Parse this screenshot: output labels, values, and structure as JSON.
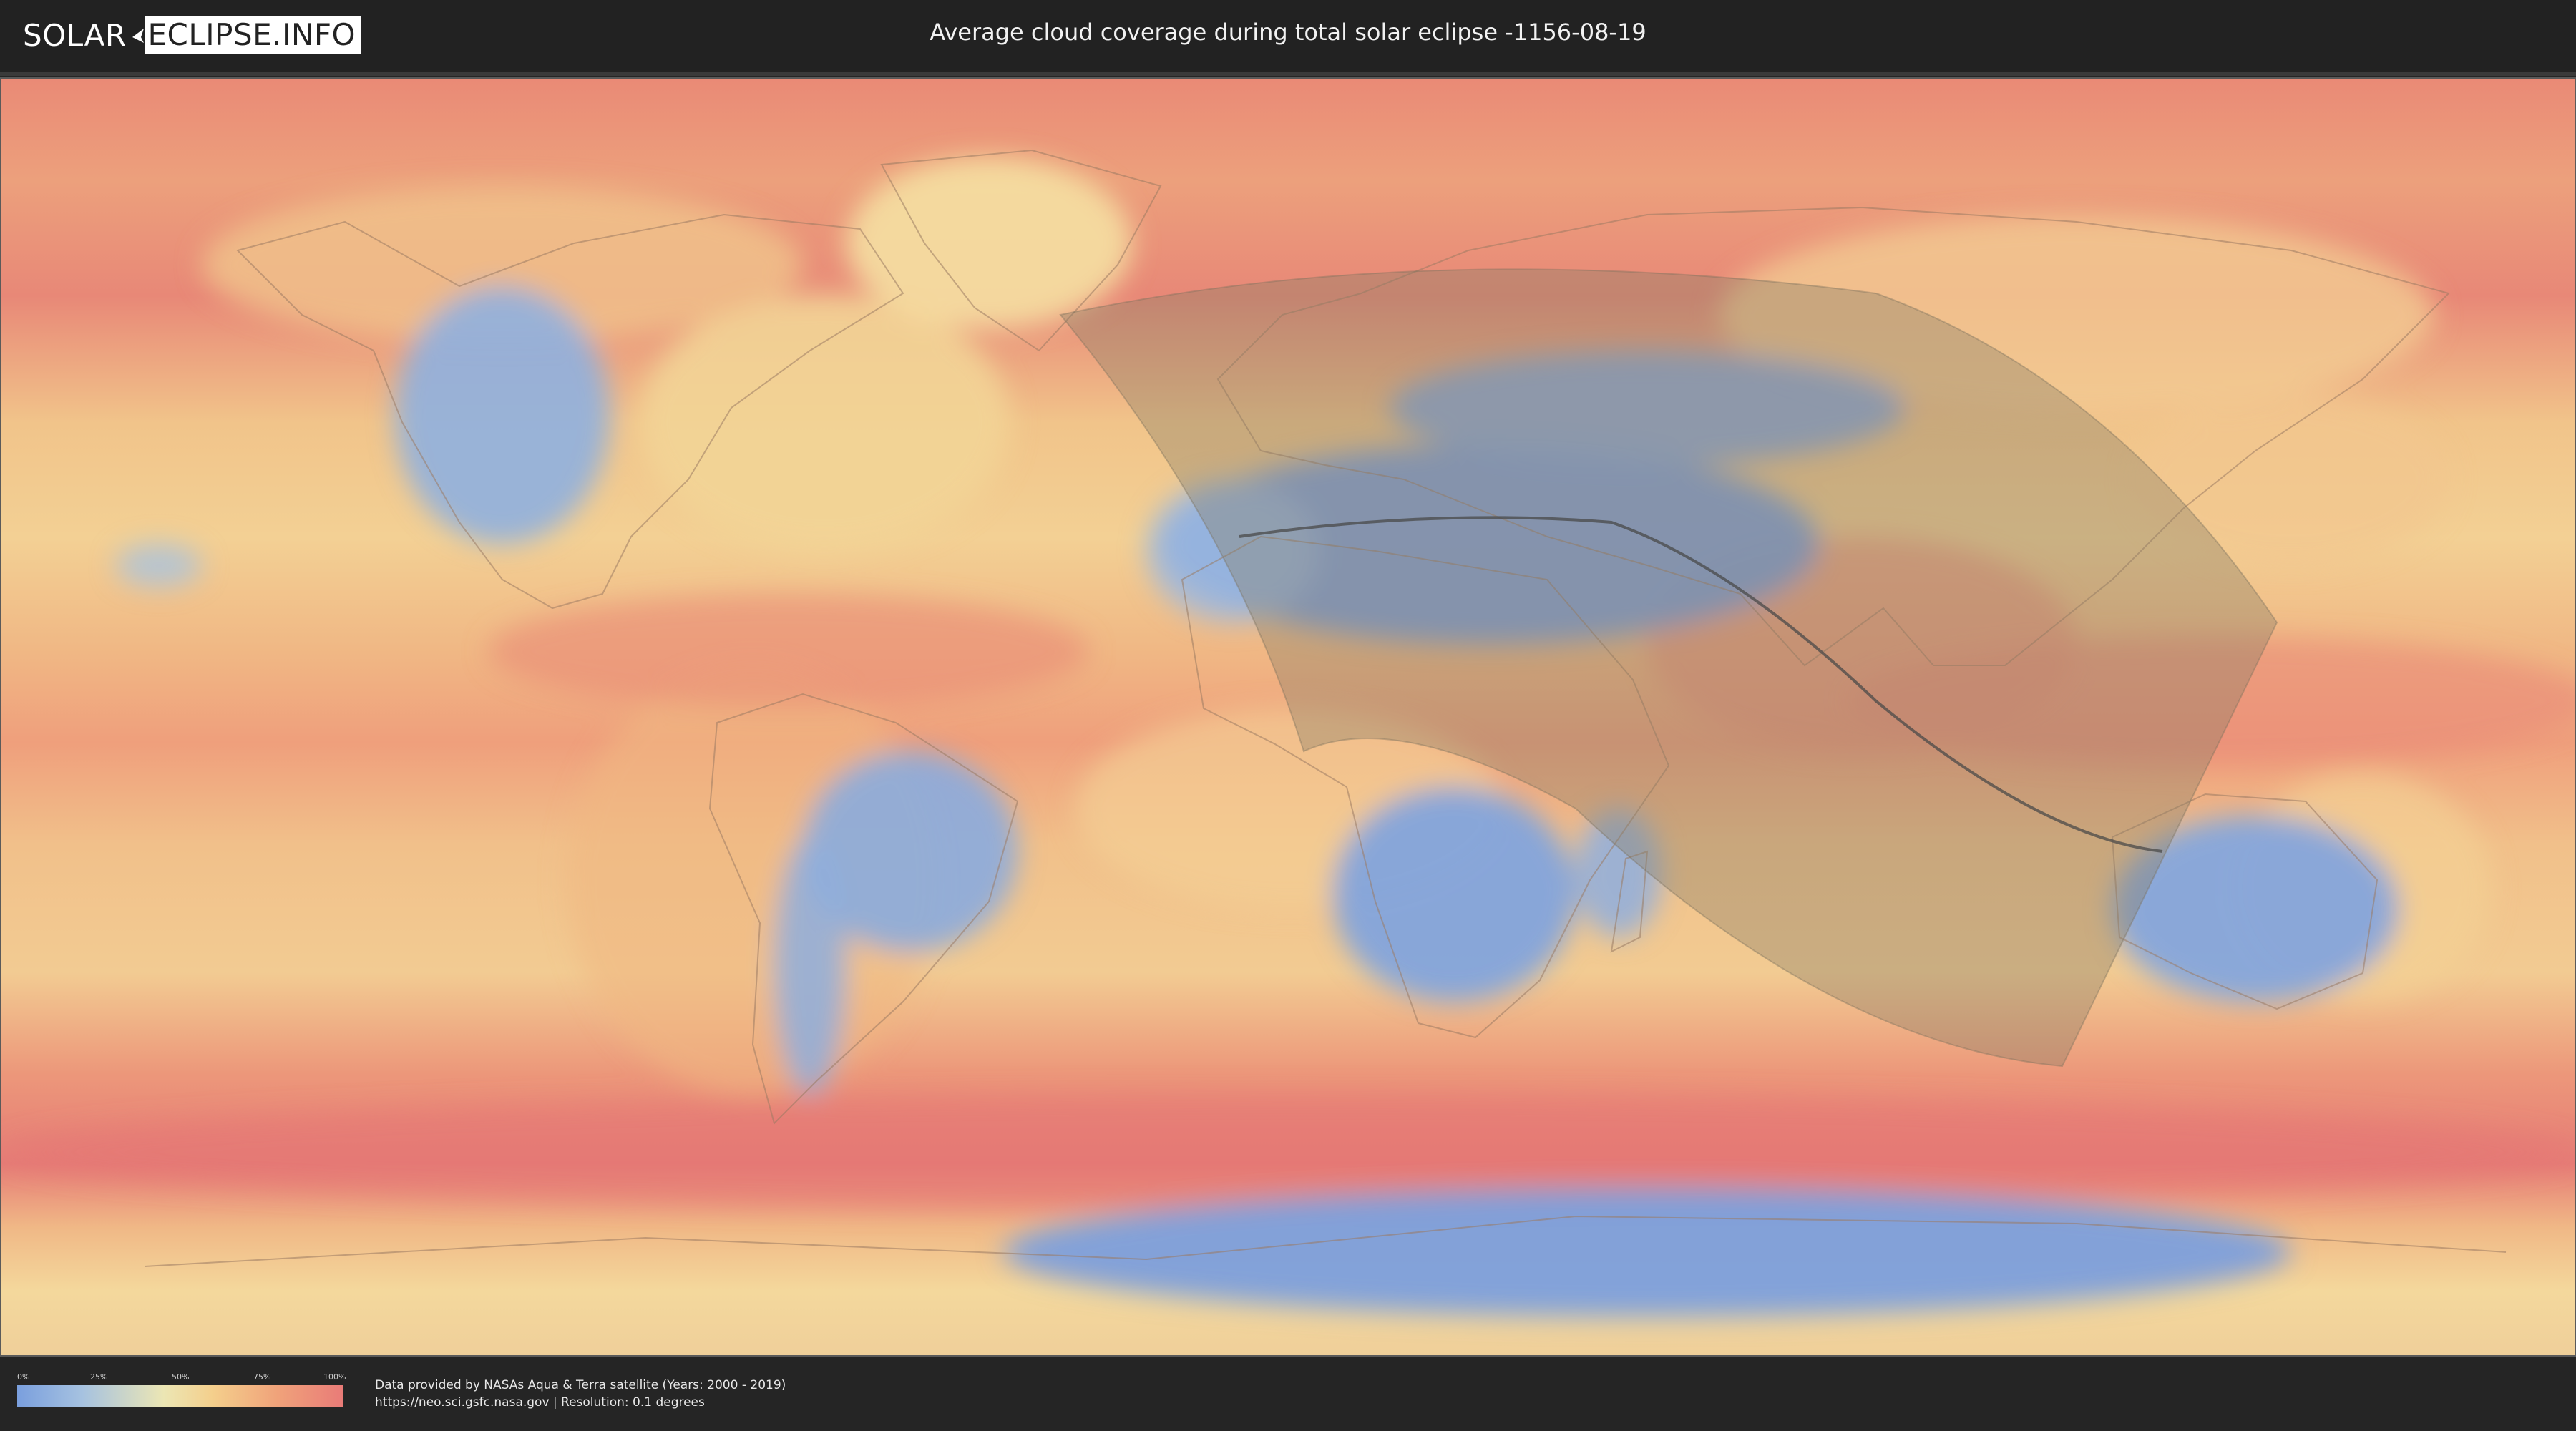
{
  "header": {
    "logo_solar": "SOLAR",
    "logo_eclipse": "ECLIPSE.INFO",
    "title": "Average cloud coverage during total solar eclipse -1156-08-19"
  },
  "map": {
    "layer": "average cloud coverage",
    "overlay": "eclipse visibility zone",
    "path": "path of totality"
  },
  "legend": {
    "ticks": [
      "0%",
      "25%",
      "50%",
      "75%",
      "100%"
    ],
    "colors": {
      "low": "#7a9fde",
      "mid": "#ece6b4",
      "high": "#e97b78"
    }
  },
  "footer": {
    "source_line1": "Data provided by NASAs Aqua & Terra satellite (Years: 2000 - 2019)",
    "source_line2": "https://neo.sci.gsfc.nasa.gov | Resolution: 0.1 degrees"
  },
  "colors": {
    "background": "#252525",
    "header": "#222222",
    "overlay": "#8a7f66"
  }
}
